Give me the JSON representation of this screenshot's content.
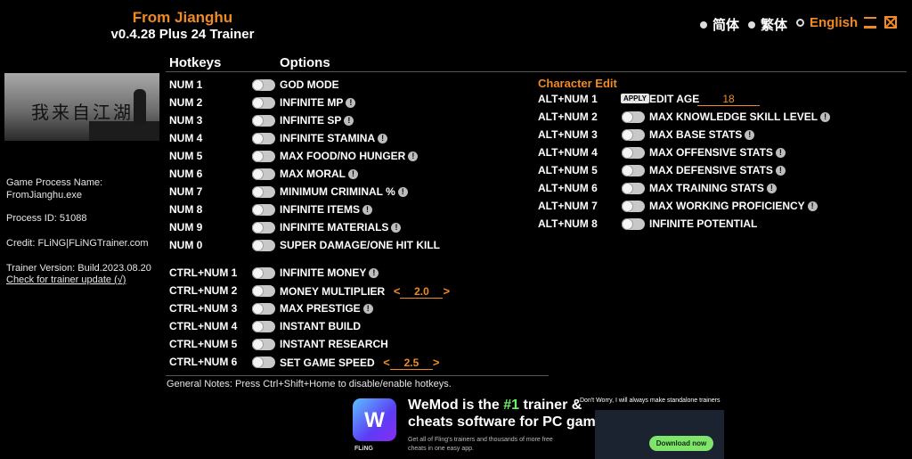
{
  "header": {
    "game_title": "From Jianghu",
    "version": "v0.4.28 Plus 24 Trainer"
  },
  "languages": [
    {
      "label": "简体",
      "selected": false
    },
    {
      "label": "繁体",
      "selected": false
    },
    {
      "label": "English",
      "selected": true
    }
  ],
  "banner": {
    "calligraphy": "我来自江湖"
  },
  "info": {
    "process_name_label": "Game Process Name:",
    "process_name": "FromJianghu.exe",
    "process_id": "Process ID: 51088",
    "credit": "Credit: FLiNG|FLiNGTrainer.com",
    "trainer_version": "Trainer Version: Build.2023.08.20",
    "update_link": "Check for trainer update (√)"
  },
  "columns": {
    "hotkeys": "Hotkeys",
    "options": "Options"
  },
  "cheats": [
    {
      "key": "NUM 1",
      "label": "GOD MODE",
      "warn": false
    },
    {
      "key": "NUM 2",
      "label": "INFINITE MP",
      "warn": true
    },
    {
      "key": "NUM 3",
      "label": "INFINITE SP",
      "warn": true
    },
    {
      "key": "NUM 4",
      "label": "INFINITE STAMINA",
      "warn": true
    },
    {
      "key": "NUM 5",
      "label": "MAX FOOD/NO HUNGER",
      "warn": true
    },
    {
      "key": "NUM 6",
      "label": "MAX MORAL",
      "warn": true
    },
    {
      "key": "NUM 7",
      "label": "MINIMUM CRIMINAL %",
      "warn": true
    },
    {
      "key": "NUM 8",
      "label": "INFINITE ITEMS",
      "warn": true
    },
    {
      "key": "NUM 9",
      "label": "INFINITE MATERIALS",
      "warn": true
    },
    {
      "key": "NUM 0",
      "label": "SUPER DAMAGE/ONE HIT KILL",
      "warn": false
    }
  ],
  "ctrl_cheats": [
    {
      "key": "CTRL+NUM 1",
      "label": "INFINITE MONEY",
      "warn": true
    },
    {
      "key": "CTRL+NUM 2",
      "label": "MONEY MULTIPLIER",
      "warn": false,
      "value": "2.0"
    },
    {
      "key": "CTRL+NUM 3",
      "label": "MAX PRESTIGE",
      "warn": true
    },
    {
      "key": "CTRL+NUM 4",
      "label": "INSTANT BUILD",
      "warn": false
    },
    {
      "key": "CTRL+NUM 5",
      "label": "INSTANT RESEARCH",
      "warn": false
    },
    {
      "key": "CTRL+NUM 6",
      "label": "SET GAME SPEED",
      "warn": false,
      "value": "2.5"
    }
  ],
  "character_edit": {
    "title": "Character Edit",
    "edit_age": {
      "key": "ALT+NUM 1",
      "apply_label": "APPLY",
      "label": "EDIT AGE",
      "value": "18"
    },
    "items": [
      {
        "key": "ALT+NUM 2",
        "label": "MAX KNOWLEDGE SKILL LEVEL",
        "warn": true
      },
      {
        "key": "ALT+NUM 3",
        "label": "MAX BASE STATS",
        "warn": true
      },
      {
        "key": "ALT+NUM 4",
        "label": "MAX OFFENSIVE STATS",
        "warn": true
      },
      {
        "key": "ALT+NUM 5",
        "label": "MAX DEFENSIVE STATS",
        "warn": true
      },
      {
        "key": "ALT+NUM 6",
        "label": "MAX TRAINING STATS",
        "warn": true
      },
      {
        "key": "ALT+NUM 7",
        "label": "MAX WORKING PROFICIENCY",
        "warn": true
      },
      {
        "key": "ALT+NUM 8",
        "label": "INFINITE POTENTIAL",
        "warn": false
      }
    ]
  },
  "notes": "General Notes: Press Ctrl+Shift+Home to disable/enable hotkeys.",
  "ad": {
    "logo_letter": "W",
    "brand": "FLiNG",
    "line1_pre": "WeMod is the ",
    "line1_num": "#1",
    "line1_post": " trainer &",
    "line2": "cheats software for PC games",
    "sub": "Get all of Fling's trainers and thousands of more free cheats in one easy app.",
    "note": "Don't Worry, I will always make standalone trainers",
    "download": "Download now"
  },
  "colors": {
    "accent": "#f08a24",
    "background": "#000000",
    "wemod_green": "#7fe36c"
  }
}
